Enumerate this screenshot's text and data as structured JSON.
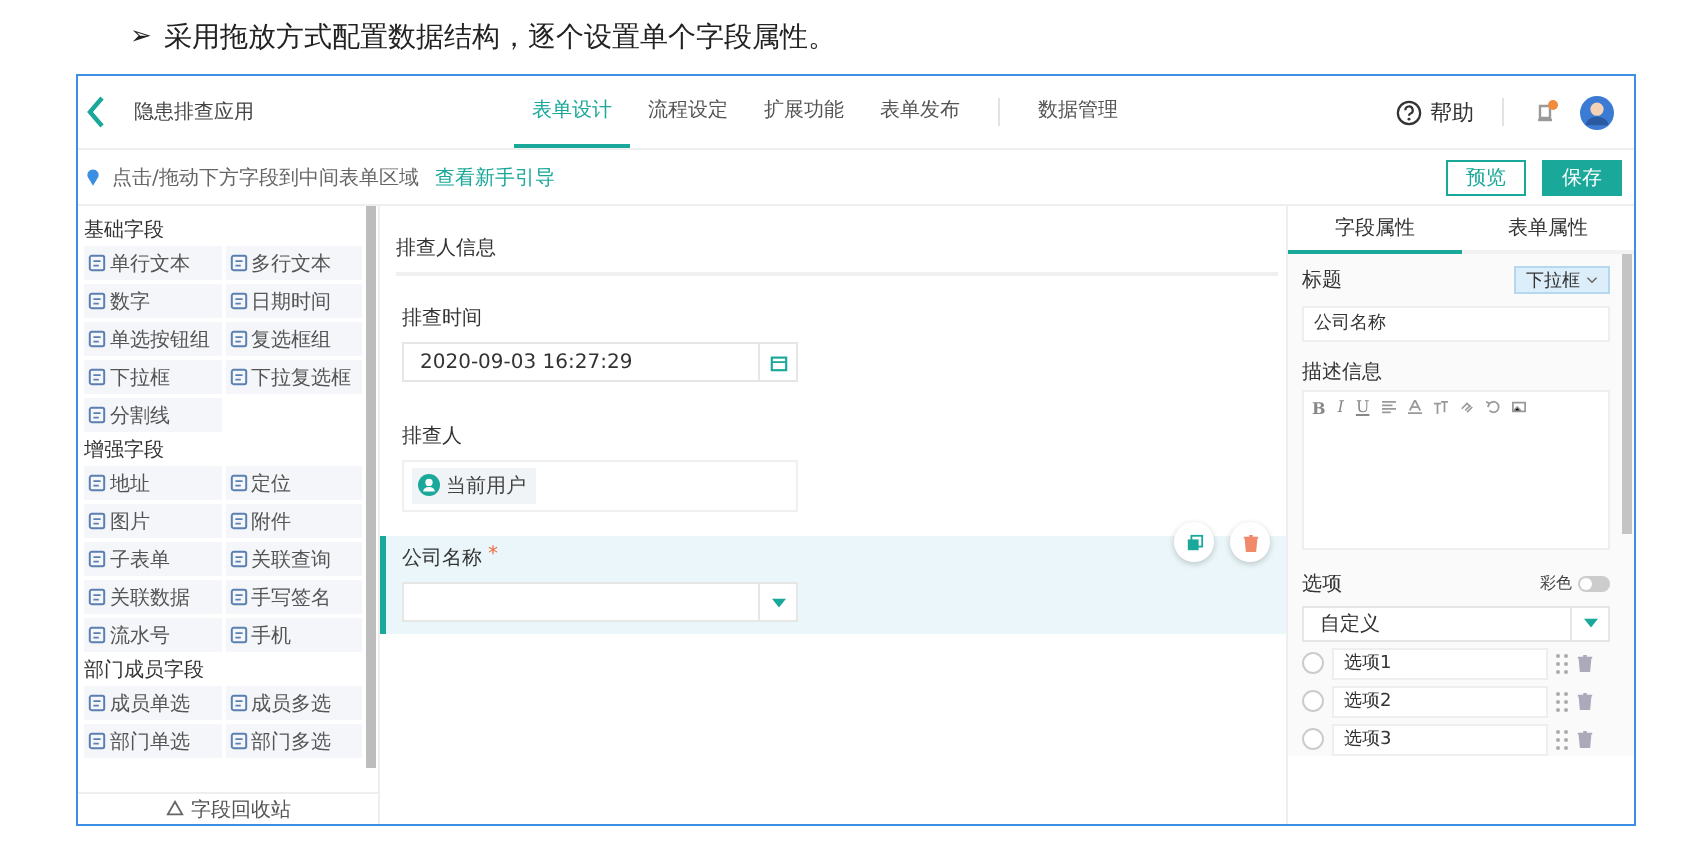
{
  "caption": {
    "bullet": "➢",
    "text": "采用拖放方式配置数据结构，逐个设置单个字段属性。"
  },
  "header": {
    "app_name": "隐患排查应用",
    "tabs": [
      {
        "label": "表单设计",
        "selected": true
      },
      {
        "label": "流程设定",
        "selected": false
      },
      {
        "label": "扩展功能",
        "selected": false
      },
      {
        "label": "表单发布",
        "selected": false
      },
      {
        "label": "数据管理",
        "selected": false
      }
    ],
    "help": "帮助",
    "notification_dot": true
  },
  "toolbar": {
    "hint": "点击/拖动下方字段到中间表单区域",
    "guide_link": "查看新手引导",
    "preview_button": "预览",
    "save_button": "保存"
  },
  "palette": {
    "groups": [
      {
        "title": "基础字段",
        "items": [
          "单行文本",
          "多行文本",
          "数字",
          "日期时间",
          "单选按钮组",
          "复选框组",
          "下拉框",
          "下拉复选框",
          "分割线"
        ]
      },
      {
        "title": "增强字段",
        "items": [
          "地址",
          "定位",
          "图片",
          "附件",
          "子表单",
          "关联查询",
          "关联数据",
          "手写签名",
          "流水号",
          "手机"
        ]
      },
      {
        "title": "部门成员字段",
        "items": [
          "成员单选",
          "成员多选",
          "部门单选",
          "部门多选"
        ]
      }
    ],
    "recycle_bin": "字段回收站"
  },
  "form": {
    "section_title": "排查人信息",
    "fields": [
      {
        "kind": "datetime",
        "label": "排查时间",
        "value": "2020-09-03 16:27:29",
        "selected": false
      },
      {
        "kind": "user",
        "label": "排查人",
        "value": "当前用户",
        "selected": false
      },
      {
        "kind": "select",
        "label": "公司名称",
        "required_mark": "*",
        "selected": true
      }
    ]
  },
  "properties": {
    "tabs": [
      {
        "label": "字段属性",
        "selected": true
      },
      {
        "label": "表单属性",
        "selected": false
      }
    ],
    "title_label": "标题",
    "type_button": "下拉框",
    "title_value": "公司名称",
    "description_label": "描述信息",
    "editor_buttons": [
      "B",
      "I",
      "U"
    ],
    "options_label": "选项",
    "color_label": "彩色",
    "color_on": false,
    "source_value": "自定义",
    "options": [
      {
        "label": "选项1",
        "selected": false
      },
      {
        "label": "选项2",
        "selected": false
      },
      {
        "label": "选项3",
        "selected": false
      }
    ]
  }
}
